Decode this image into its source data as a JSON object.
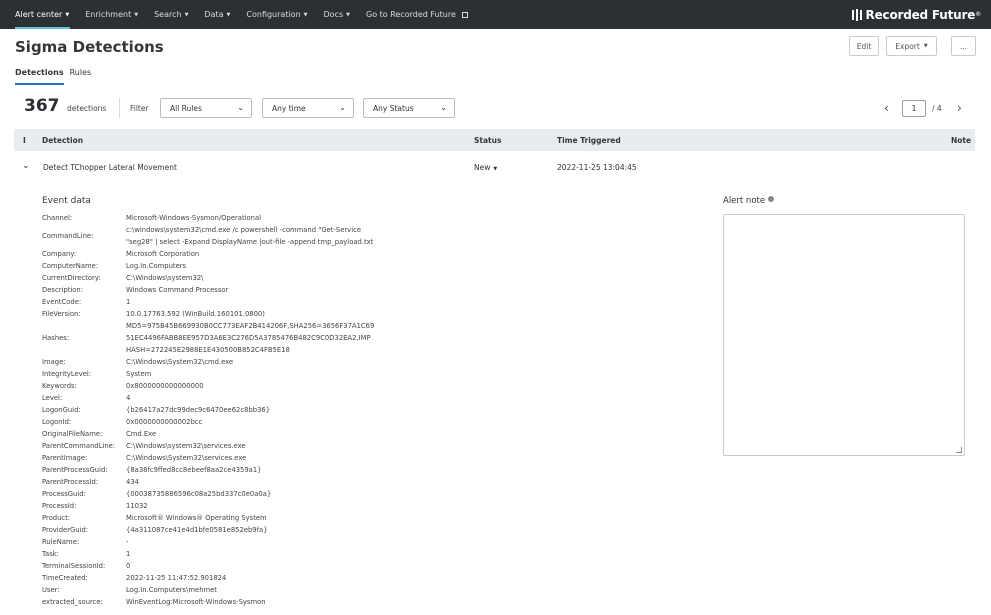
{
  "nav": {
    "items": [
      {
        "label": "Alert center",
        "caret": true
      },
      {
        "label": "Enrichment",
        "caret": true
      },
      {
        "label": "Search",
        "caret": true
      },
      {
        "label": "Data",
        "caret": true
      },
      {
        "label": "Configuration",
        "caret": true
      },
      {
        "label": "Docs",
        "caret": true
      },
      {
        "label": "Go to Recorded Future",
        "caret": false
      }
    ],
    "brand": "Recorded Future",
    "brand_suffix": "®"
  },
  "header": {
    "title": "Sigma Detections",
    "edit_label": "Edit",
    "export_label": "Export",
    "more_label": "..."
  },
  "tabs": [
    {
      "label": "Detections",
      "active": true
    },
    {
      "label": "Rules",
      "active": false
    }
  ],
  "toolbar": {
    "count": "367",
    "count_label": "detections",
    "filter_label": "Filter",
    "rule_filter": "All Rules",
    "time_filter": "Any time",
    "status_filter": "Any Status",
    "page_current": "1",
    "page_total": "/ 4"
  },
  "table": {
    "columns": {
      "indicator": "I",
      "detection": "Detection",
      "status": "Status",
      "time": "Time Triggered",
      "note": "Note"
    },
    "rows": [
      {
        "detection": "Detect TChopper Lateral Movement",
        "status": "New",
        "time": "2022-11-25 13:04:45"
      }
    ]
  },
  "event": {
    "title": "Event data",
    "fields": [
      {
        "key": "Channel:",
        "value": "Microsoft-Windows-Sysmon/Operational"
      },
      {
        "key": "CommandLine:",
        "value": "c:\\windows\\system32\\cmd.exe /c powershell -command \"Get-Service\n\"seg28\" | select -Expand DisplayName |out-file -append tmp_payload.txt"
      },
      {
        "key": "Company:",
        "value": "Microsoft Corporation"
      },
      {
        "key": "ComputerName:",
        "value": "Log.In.Computers"
      },
      {
        "key": "CurrentDirectory:",
        "value": "C:\\Windows\\system32\\"
      },
      {
        "key": "Description:",
        "value": "Windows Command Processor"
      },
      {
        "key": "EventCode:",
        "value": "1"
      },
      {
        "key": "FileVersion:",
        "value": "10.0.17763.592 (WinBuild.160101.0800)"
      },
      {
        "key": "Hashes:",
        "value": "MD5=975B45B669930B0CC773EAF2B414206F,SHA256=3656F37A1C69\n51EC4496FABB8EE957D3A6E3C276D5A3785476B482C9C0D32EA2,IMP\nHASH=272245E2988E1E430500B852C4FB5E18"
      },
      {
        "key": "Image:",
        "value": "C:\\Windows\\System32\\cmd.exe"
      },
      {
        "key": "IntegrityLevel:",
        "value": "System"
      },
      {
        "key": "Keywords:",
        "value": "0x8000000000000000"
      },
      {
        "key": "Level:",
        "value": "4"
      },
      {
        "key": "LogonGuid:",
        "value": "{b26417a27dc99dec9c6470ee62c8bb36}"
      },
      {
        "key": "LogonId:",
        "value": "0x0000000000002bcc"
      },
      {
        "key": "OriginalFileName:",
        "value": "Cmd.Exe"
      },
      {
        "key": "ParentCommandLine:",
        "value": "C:\\Windows\\system32\\services.exe"
      },
      {
        "key": "ParentImage:",
        "value": "C:\\Windows\\System32\\services.exe"
      },
      {
        "key": "ParentProcessGuid:",
        "value": "{8a38fc9ffed8cc8ebeef8aa2ce4359a1}"
      },
      {
        "key": "ParentProcessId:",
        "value": "434"
      },
      {
        "key": "ProcessGuid:",
        "value": "{00038735886596c08a25bd337c0e0a0a}"
      },
      {
        "key": "ProcessId:",
        "value": "11032"
      },
      {
        "key": "Product:",
        "value": "Microsoft® Windows® Operating System"
      },
      {
        "key": "ProviderGuid:",
        "value": "{4a311087ce41e4d1bfe0581e852eb9fa}"
      },
      {
        "key": "RuleName:",
        "value": "-"
      },
      {
        "key": "Task:",
        "value": "1"
      },
      {
        "key": "TerminalSessionId:",
        "value": "0"
      },
      {
        "key": "TimeCreated:",
        "value": "2022-11-25 11:47:52.901824"
      },
      {
        "key": "User:",
        "value": "Log.In.Computers\\mehmet"
      },
      {
        "key": "extracted_source:",
        "value": "WinEventLog:Microsoft-Windows-Sysmon"
      }
    ]
  },
  "alert_note": {
    "title": "Alert note",
    "value": ""
  }
}
